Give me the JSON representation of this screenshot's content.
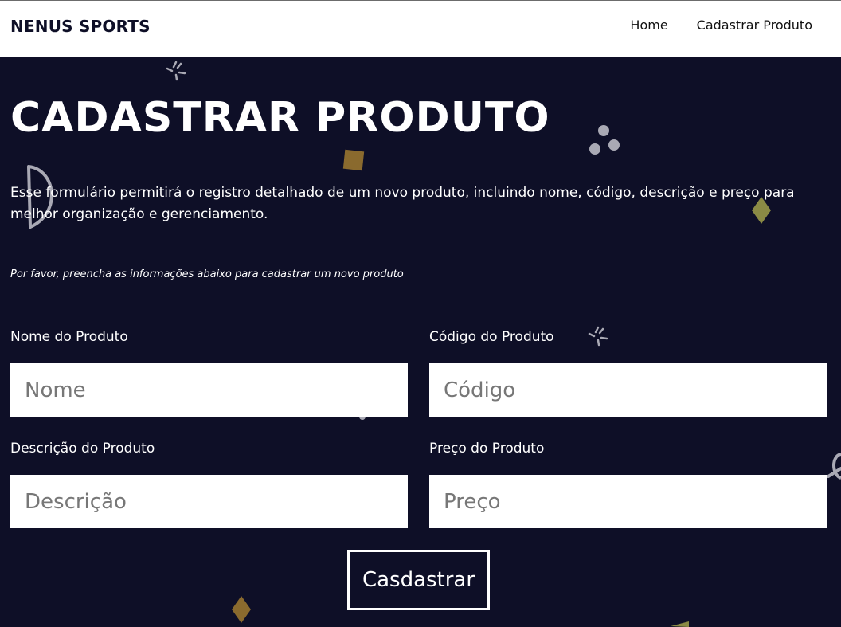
{
  "header": {
    "brand": "NENUS SPORTS",
    "nav": [
      {
        "label": "Home"
      },
      {
        "label": "Cadastrar Produto"
      }
    ]
  },
  "main": {
    "title": "CADASTRAR PRODUTO",
    "intro": "Esse formulário permitirá o registro detalhado de um novo produto, incluindo nome, código, descrição e preço para melhor organização e gerenciamento.",
    "hint": "Por favor, preencha as informações abaixo para cadastrar um novo produto"
  },
  "form": {
    "name": {
      "label": "Nome do Produto",
      "placeholder": "Nome",
      "value": ""
    },
    "code": {
      "label": "Código do Produto",
      "placeholder": "Código",
      "value": ""
    },
    "description": {
      "label": "Descrição do Produto",
      "placeholder": "Descrição",
      "value": ""
    },
    "price": {
      "label": "Preço do Produto",
      "placeholder": "Preço",
      "value": ""
    },
    "submit_label": "Casdastrar"
  },
  "colors": {
    "background": "#0e0f27",
    "header_bg": "#ffffff",
    "text": "#ffffff",
    "deco_brown": "#8a6a2e",
    "deco_olive": "#8a8a45",
    "deco_gray": "#a9a9b4"
  }
}
